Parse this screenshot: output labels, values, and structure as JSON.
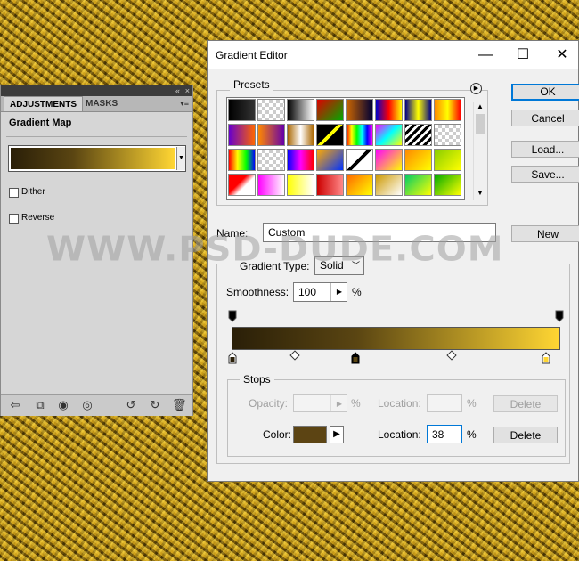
{
  "adjustments_panel": {
    "tabs": [
      "ADJUSTMENTS",
      "MASKS"
    ],
    "collapse_icon": "«",
    "close_icon": "×",
    "menu_icon": "▾≡",
    "title": "Gradient Map",
    "dither_label": "Dither",
    "reverse_label": "Reverse",
    "dither_checked": false,
    "reverse_checked": false
  },
  "dialog": {
    "title": "Gradient Editor",
    "minimize_glyph": "—",
    "maximize_glyph": "☐",
    "close_glyph": "✕",
    "presets_label": "Presets",
    "ok_label": "OK",
    "cancel_label": "Cancel",
    "load_label": "Load...",
    "save_label": "Save...",
    "name_label": "Name:",
    "name_value": "Custom",
    "new_label": "New",
    "gradient_type_label": "Gradient Type:",
    "gradient_type_value": "Solid",
    "smoothness_label": "Smoothness:",
    "smoothness_value": "100",
    "smoothness_unit": "%",
    "stops_label": "Stops",
    "opacity_label": "Opacity:",
    "opacity_unit": "%",
    "opacity_location_label": "Location:",
    "opacity_location_unit": "%",
    "delete_label": "Delete",
    "color_label": "Color:",
    "color_location_label": "Location:",
    "color_location_value": "38",
    "color_location_unit": "%"
  },
  "watermark": "WWW.PSD-DUDE.COM",
  "gradient": {
    "stops": [
      {
        "location": 0,
        "color": "#2a1f08"
      },
      {
        "location": 38,
        "color": "#5a4512"
      },
      {
        "location": 100,
        "color": "#ffd633"
      }
    ],
    "selected_stop_location": 38,
    "selected_color": "#5c4413"
  }
}
